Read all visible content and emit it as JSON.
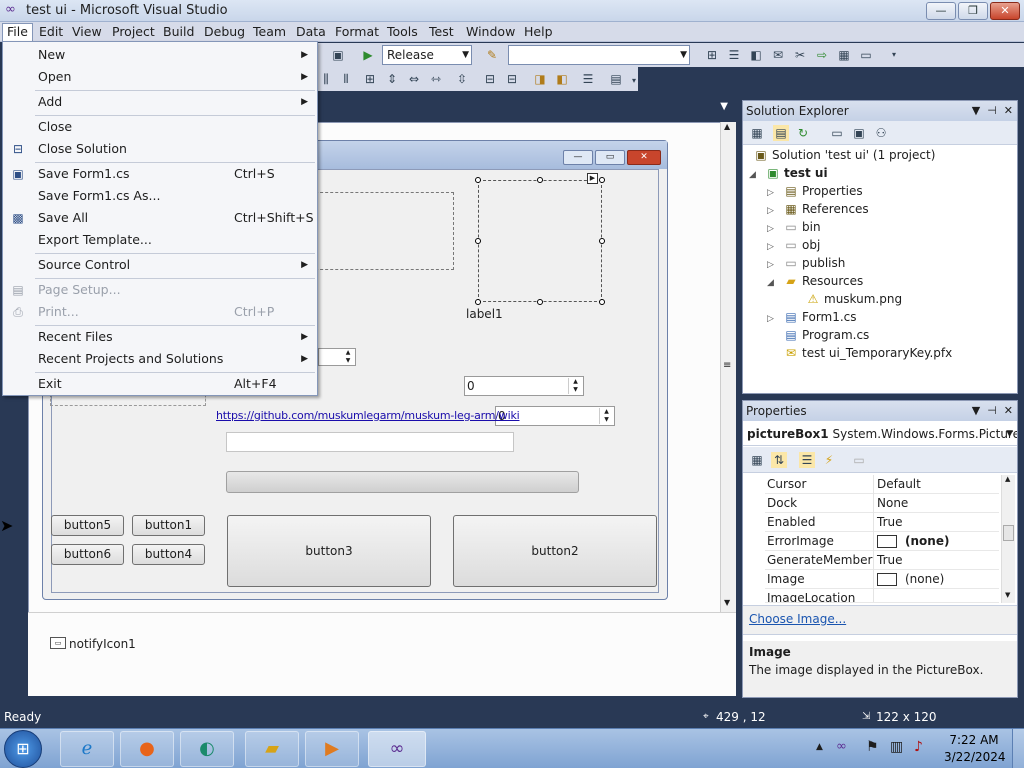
{
  "window": {
    "title": "test ui - Microsoft Visual Studio",
    "min_glyph": "—",
    "max_glyph": "❐",
    "close_glyph": "✕"
  },
  "menubar": {
    "items": [
      "File",
      "Edit",
      "View",
      "Project",
      "Build",
      "Debug",
      "Team",
      "Data",
      "Format",
      "Tools",
      "Test",
      "Window",
      "Help"
    ]
  },
  "toolbar": {
    "config_value": "Release",
    "platform_value": ""
  },
  "file_menu": {
    "items": [
      {
        "label": "New",
        "shortcut": "",
        "submenu": true,
        "disabled": false
      },
      {
        "label": "Open",
        "shortcut": "",
        "submenu": true,
        "disabled": false
      },
      {
        "label": "Add",
        "shortcut": "",
        "submenu": true,
        "disabled": false
      },
      {
        "label": "Close",
        "shortcut": "",
        "submenu": false,
        "disabled": false
      },
      {
        "label": "Close Solution",
        "shortcut": "",
        "submenu": false,
        "disabled": false
      },
      {
        "label": "Save Form1.cs",
        "shortcut": "Ctrl+S",
        "submenu": false,
        "disabled": false
      },
      {
        "label": "Save Form1.cs As...",
        "shortcut": "",
        "submenu": false,
        "disabled": false
      },
      {
        "label": "Save All",
        "shortcut": "Ctrl+Shift+S",
        "submenu": false,
        "disabled": false
      },
      {
        "label": "Export Template...",
        "shortcut": "",
        "submenu": false,
        "disabled": false
      },
      {
        "label": "Source Control",
        "shortcut": "",
        "submenu": true,
        "disabled": false
      },
      {
        "label": "Page Setup...",
        "shortcut": "",
        "submenu": false,
        "disabled": true
      },
      {
        "label": "Print...",
        "shortcut": "Ctrl+P",
        "submenu": false,
        "disabled": true
      },
      {
        "label": "Recent Files",
        "shortcut": "",
        "submenu": true,
        "disabled": false
      },
      {
        "label": "Recent Projects and Solutions",
        "shortcut": "",
        "submenu": true,
        "disabled": false
      },
      {
        "label": "Exit",
        "shortcut": "Alt+F4",
        "submenu": false,
        "disabled": false
      }
    ]
  },
  "form_designer": {
    "label1": "label1",
    "link": "https://github.com/muskumlegarm/muskum-leg-arm/wiki",
    "numeric1": "0",
    "numeric2": "0",
    "buttons": {
      "button1": "button1",
      "button2": "button2",
      "button3": "button3",
      "button4": "button4",
      "button5": "button5",
      "button6": "button6"
    },
    "tray_component": "notifyIcon1"
  },
  "solution_explorer": {
    "title": "Solution Explorer",
    "solution": "Solution 'test ui' (1 project)",
    "project": "test ui",
    "nodes": [
      "Properties",
      "References",
      "bin",
      "obj",
      "publish",
      "Resources",
      "muskum.png",
      "Form1.cs",
      "Program.cs",
      "test ui_TemporaryKey.pfx"
    ]
  },
  "properties": {
    "title": "Properties",
    "object_name": "pictureBox1",
    "object_type": "System.Windows.Forms.PictureBo",
    "rows": [
      {
        "name": "Cursor",
        "value": "Default"
      },
      {
        "name": "Dock",
        "value": "None"
      },
      {
        "name": "Enabled",
        "value": "True"
      },
      {
        "name": "ErrorImage",
        "value": "(none)"
      },
      {
        "name": "GenerateMember",
        "value": "True"
      },
      {
        "name": "Image",
        "value": "(none)"
      },
      {
        "name": "ImageLocation",
        "value": ""
      }
    ],
    "link": "Choose Image...",
    "desc_title": "Image",
    "desc_text": "The image displayed in the PictureBox."
  },
  "statusbar": {
    "text": "Ready",
    "position": "429 , 12",
    "size": "122 x 120"
  },
  "taskbar": {
    "time": "7:22 AM",
    "date": "3/22/2024"
  }
}
